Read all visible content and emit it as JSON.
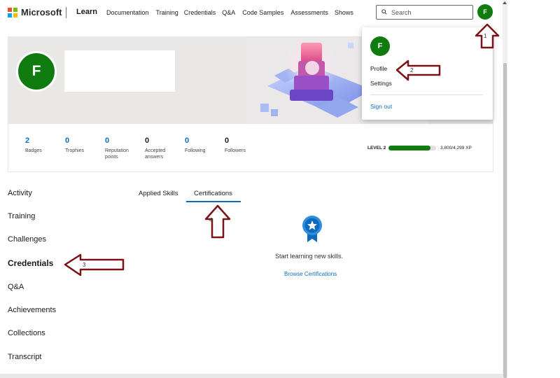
{
  "header": {
    "brand": "Microsoft",
    "product": "Learn",
    "nav": [
      "Documentation",
      "Training",
      "Credentials",
      "Q&A",
      "Code Samples",
      "Assessments",
      "Shows"
    ],
    "search_placeholder": "Search",
    "avatar_initial": "F"
  },
  "profile": {
    "avatar_initial": "F",
    "stats": [
      {
        "value": "2",
        "label": "Badges"
      },
      {
        "value": "0",
        "label": "Trophies"
      },
      {
        "value": "0",
        "label": "Reputation points"
      },
      {
        "value": "0",
        "label": "Accepted answers"
      },
      {
        "value": "0",
        "label": "Following"
      },
      {
        "value": "0",
        "label": "Followers"
      }
    ],
    "level_label": "LEVEL 2",
    "xp_text": "3,800/4,299 XP",
    "xp_progress": 0.884
  },
  "menu": {
    "avatar_initial": "F",
    "profile": "Profile",
    "settings": "Settings",
    "signout": "Sign out"
  },
  "sidebar": {
    "items": [
      "Activity",
      "Training",
      "Challenges",
      "Credentials",
      "Q&A",
      "Achievements",
      "Collections",
      "Transcript"
    ],
    "active": "Credentials"
  },
  "tabs": {
    "applied_skills": "Applied Skills",
    "certifications": "Certifications",
    "active": "Certifications"
  },
  "empty_state": {
    "message": "Start learning new skills.",
    "link": "Browse Certifications"
  },
  "annotations": [
    "1",
    "2",
    "3",
    "4"
  ],
  "colors": {
    "accent": "#0f6cbd",
    "avatar": "#107c10",
    "arrow": "#7a1418"
  }
}
